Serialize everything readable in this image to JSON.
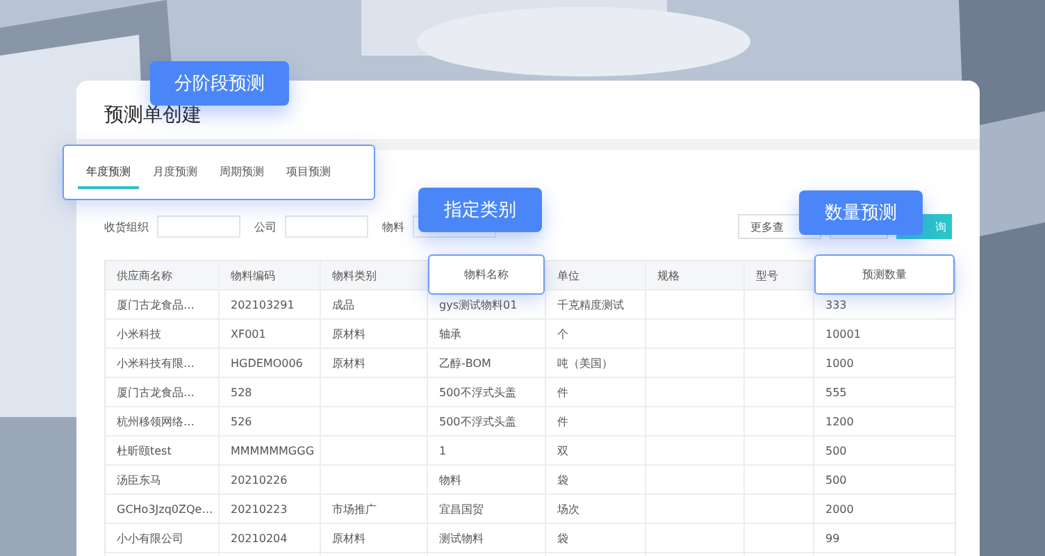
{
  "callouts": [
    "分阶段预测",
    "指定类别",
    "数量预测"
  ],
  "title": "预测单创建",
  "tabs": [
    {
      "label": "年度预测",
      "selected": true
    },
    {
      "label": "月度预测",
      "selected": false
    },
    {
      "label": "周期预测",
      "selected": false
    },
    {
      "label": "项目预测",
      "selected": false
    }
  ],
  "filters": [
    {
      "label": "收货组织"
    },
    {
      "label": "公司"
    },
    {
      "label": "物料"
    }
  ],
  "buttons": [
    {
      "label": "更多查",
      "kind": "outline"
    },
    {
      "kind": "outline"
    },
    {
      "label": "询",
      "kind": "primary"
    }
  ],
  "table": {
    "columns": [
      {
        "label": "供应商名称",
        "highlighted": false
      },
      {
        "label": "物料编码",
        "highlighted": false
      },
      {
        "label": "物料类别",
        "highlighted": false
      },
      {
        "label": "物料名称",
        "highlighted": true
      },
      {
        "label": "单位",
        "highlighted": false
      },
      {
        "label": "规格",
        "highlighted": false
      },
      {
        "label": "型号",
        "highlighted": false
      },
      {
        "label": "预测数量",
        "highlighted": true
      }
    ],
    "rows": [
      [
        "厦门古龙食品…",
        "202103291",
        "成品",
        "gys测试物料01",
        "千克精度测试",
        "",
        "",
        "333"
      ],
      [
        "小米科技",
        "XF001",
        "原材料",
        "轴承",
        "个",
        "",
        "",
        "10001"
      ],
      [
        "小米科技有限…",
        "HGDEMO006",
        "原材料",
        "乙醇-BOM",
        "吨（美国）",
        "",
        "",
        "1000"
      ],
      [
        "厦门古龙食品…",
        "528",
        "",
        "500不浮式头盖",
        "件",
        "",
        "",
        "555"
      ],
      [
        "杭州移领网络…",
        "526",
        "",
        "500不浮式头盖",
        "件",
        "",
        "",
        "1200"
      ],
      [
        "杜昕颐test",
        "MMMMMMGGG",
        "",
        "1",
        "双",
        "",
        "",
        "500"
      ],
      [
        "汤臣东马",
        "20210226",
        "",
        "物料",
        "袋",
        "",
        "",
        "500"
      ],
      [
        "GCHo3Jzq0ZQe…",
        "20210223",
        "市场推广",
        "宜昌国贸",
        "场次",
        "",
        "",
        "2000"
      ],
      [
        "小小有限公司",
        "20210204",
        "原材料",
        "测试物料",
        "袋",
        "",
        "",
        "99"
      ]
    ]
  }
}
